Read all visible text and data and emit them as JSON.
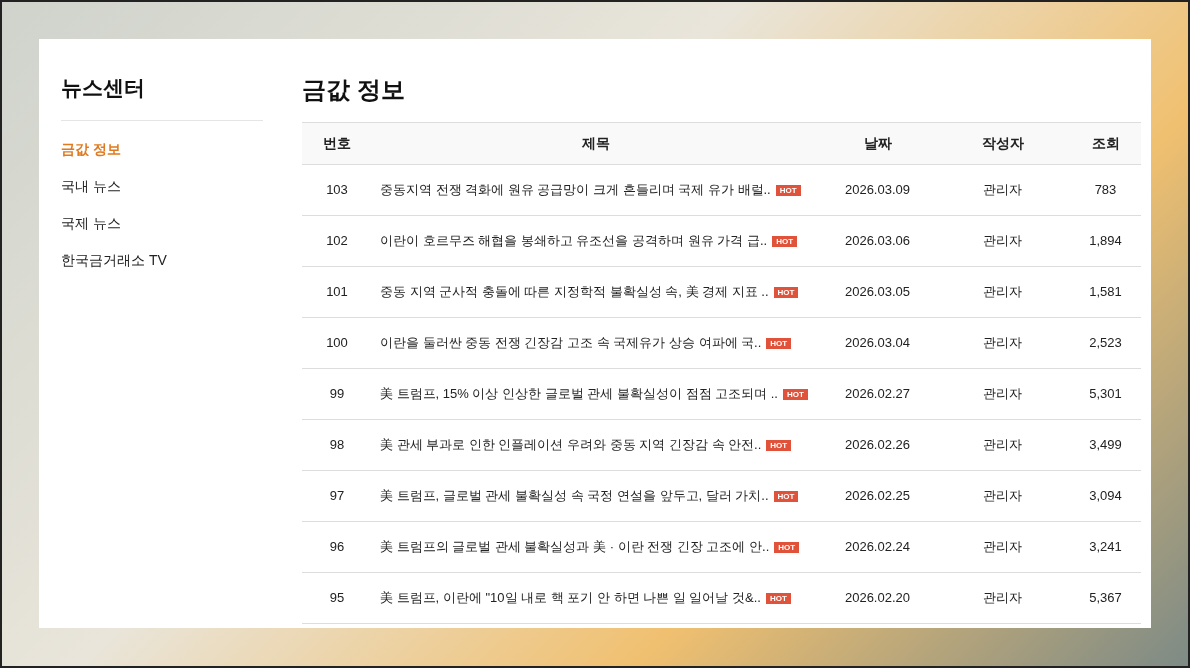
{
  "sidebar": {
    "title": "뉴스센터",
    "items": [
      {
        "label": "금값 정보",
        "selected": true
      },
      {
        "label": "국내 뉴스",
        "selected": false
      },
      {
        "label": "국제 뉴스",
        "selected": false
      },
      {
        "label": "한국금거래소 TV",
        "selected": false
      }
    ]
  },
  "page_title": "금값 정보",
  "table": {
    "columns": [
      "번호",
      "제목",
      "날짜",
      "작성자",
      "조회"
    ],
    "rows": [
      {
        "no": "103",
        "title": "중동지역 전쟁 격화에 원유 공급망이 크게 흔들리며 국제 유가 배럴..",
        "badge": "HOT",
        "date": "2026.03.09",
        "author": "관리자",
        "views": "783"
      },
      {
        "no": "102",
        "title": "이란이 호르무즈 해협을 봉쇄하고 유조선을 공격하며 원유 가격 급..",
        "badge": "HOT",
        "date": "2026.03.06",
        "author": "관리자",
        "views": "1,894"
      },
      {
        "no": "101",
        "title": "중동 지역 군사적 충돌에 따른 지정학적 불확실성 속, 美 경제 지표 ..",
        "badge": "HOT",
        "date": "2026.03.05",
        "author": "관리자",
        "views": "1,581"
      },
      {
        "no": "100",
        "title": "이란을 둘러싼 중동 전쟁 긴장감 고조 속 국제유가 상승 여파에 국..",
        "badge": "HOT",
        "date": "2026.03.04",
        "author": "관리자",
        "views": "2,523"
      },
      {
        "no": "99",
        "title": "美 트럼프, 15% 이상 인상한 글로벌 관세 불확실성이 점점 고조되며 ..",
        "badge": "HOT",
        "date": "2026.02.27",
        "author": "관리자",
        "views": "5,301"
      },
      {
        "no": "98",
        "title": "美 관세 부과로 인한 인플레이션 우려와 중동 지역 긴장감 속 안전..",
        "badge": "HOT",
        "date": "2026.02.26",
        "author": "관리자",
        "views": "3,499"
      },
      {
        "no": "97",
        "title": "美 트럼프, 글로벌 관세 불확실성 속 국정 연설을 앞두고, 달러 가치..",
        "badge": "HOT",
        "date": "2026.02.25",
        "author": "관리자",
        "views": "3,094"
      },
      {
        "no": "96",
        "title": "美 트럼프의 글로벌 관세 불확실성과 美 · 이란 전쟁 긴장 고조에 안..",
        "badge": "HOT",
        "date": "2026.02.24",
        "author": "관리자",
        "views": "3,241"
      },
      {
        "no": "95",
        "title": "美 트럼프, 이란에 \"10일 내로 핵 포기 안 하면 나쁜 일 일어날 것&..",
        "badge": "HOT",
        "date": "2026.02.20",
        "author": "관리자",
        "views": "5,367"
      }
    ]
  }
}
